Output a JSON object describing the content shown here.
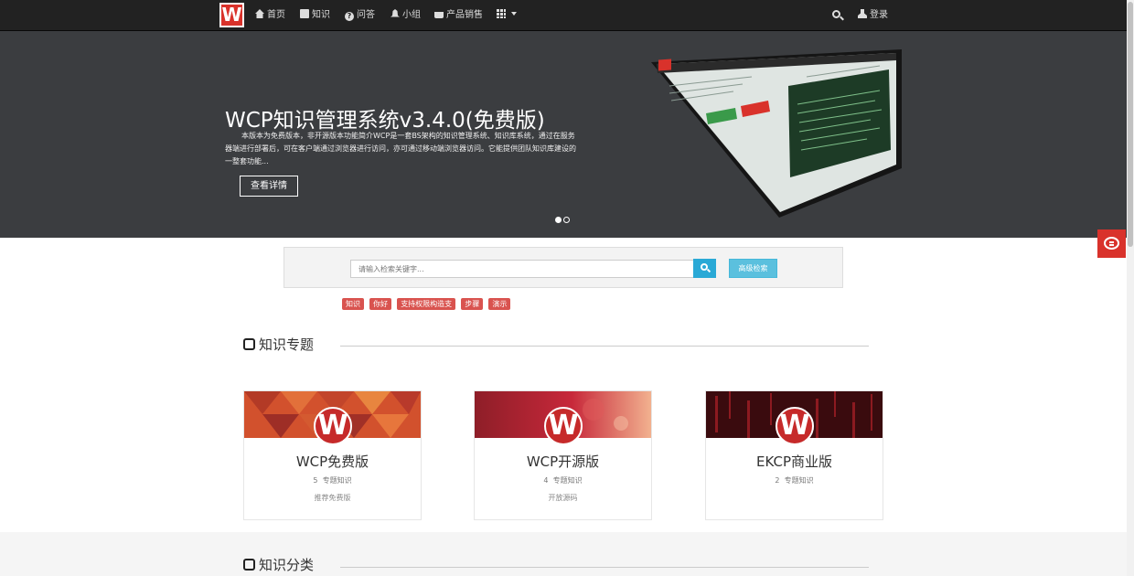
{
  "nav": {
    "logo": "W",
    "items": [
      {
        "label": "首页",
        "icon": "home-icon"
      },
      {
        "label": "知识",
        "icon": "book-icon"
      },
      {
        "label": "问答",
        "icon": "question-icon"
      },
      {
        "label": "小组",
        "icon": "bell-icon"
      },
      {
        "label": "产品销售",
        "icon": "phone-icon"
      }
    ],
    "apps_icon": "grid-icon",
    "login": "登录"
  },
  "banner": {
    "title": "WCP知识管理系统v3.4.0(免费版)",
    "description": "本版本为免费版本，非开源版本功能简介WCP是一套BS架构的知识管理系统、知识库系统，通过在服务器端进行部署后，可在客户端通过浏览器进行访问，亦可通过移动端浏览器访问。它能提供团队知识库建设的一整套功能...",
    "button": "查看详情",
    "slides": 2,
    "active_slide": 1
  },
  "search": {
    "placeholder": "请输入检索关键字...",
    "advanced": "高级检索",
    "tags": [
      "知识",
      "你好",
      "支持权限构造支",
      "步骤",
      "演示"
    ]
  },
  "sections": {
    "topics_title": "知识专题",
    "categories_title": "知识分类"
  },
  "cards": [
    {
      "title": "WCP免费版",
      "count": "5",
      "count_label": "专题知识",
      "sub": "推荐免费版"
    },
    {
      "title": "WCP开源版",
      "count": "4",
      "count_label": "专题知识",
      "sub": "开放源码"
    },
    {
      "title": "EKCP商业版",
      "count": "2",
      "count_label": "专题知识",
      "sub": ""
    }
  ],
  "colors": {
    "brand_red": "#d9322b",
    "navbar": "#222222",
    "banner": "#3b3d40",
    "info_blue": "#5bc0de",
    "search_blue": "#2aa9d6",
    "tag_red": "#d9534f"
  }
}
